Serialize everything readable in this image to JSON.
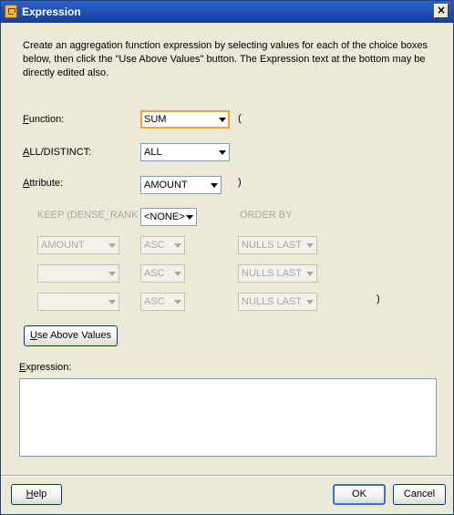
{
  "window": {
    "title": "Expression",
    "close_label": "×"
  },
  "description": "Create an aggregation function expression by selecting values for each of the choice boxes below, then click the \"Use Above Values\" button.  The Expression text at the bottom may be directly edited also.",
  "function": {
    "label_key": "F",
    "label_rest": "unction:",
    "value": "SUM",
    "paren_open": "("
  },
  "all_distinct": {
    "label_key": "A",
    "label_rest": "LL/DISTINCT:",
    "value": "ALL"
  },
  "attribute": {
    "label_key": "A",
    "label_rest": "ttribute:",
    "value": "AMOUNT",
    "paren_close": ")"
  },
  "keep": {
    "label": "KEEP (DENSE_RANK",
    "value": "<NONE>",
    "order_by_label": "ORDER BY",
    "rows": [
      {
        "column": "AMOUNT",
        "direction": "ASC",
        "nulls": "NULLS LAST"
      },
      {
        "column": "",
        "direction": "ASC",
        "nulls": "NULLS LAST"
      },
      {
        "column": "",
        "direction": "ASC",
        "nulls": "NULLS LAST"
      }
    ],
    "paren_close": ")"
  },
  "use_above": {
    "label_key": "U",
    "label_rest": "se Above Values"
  },
  "expression": {
    "label_key": "E",
    "label_rest": "xpression:",
    "value": ""
  },
  "buttons": {
    "help_key": "H",
    "help_rest": "elp",
    "ok": "OK",
    "cancel": "Cancel"
  }
}
